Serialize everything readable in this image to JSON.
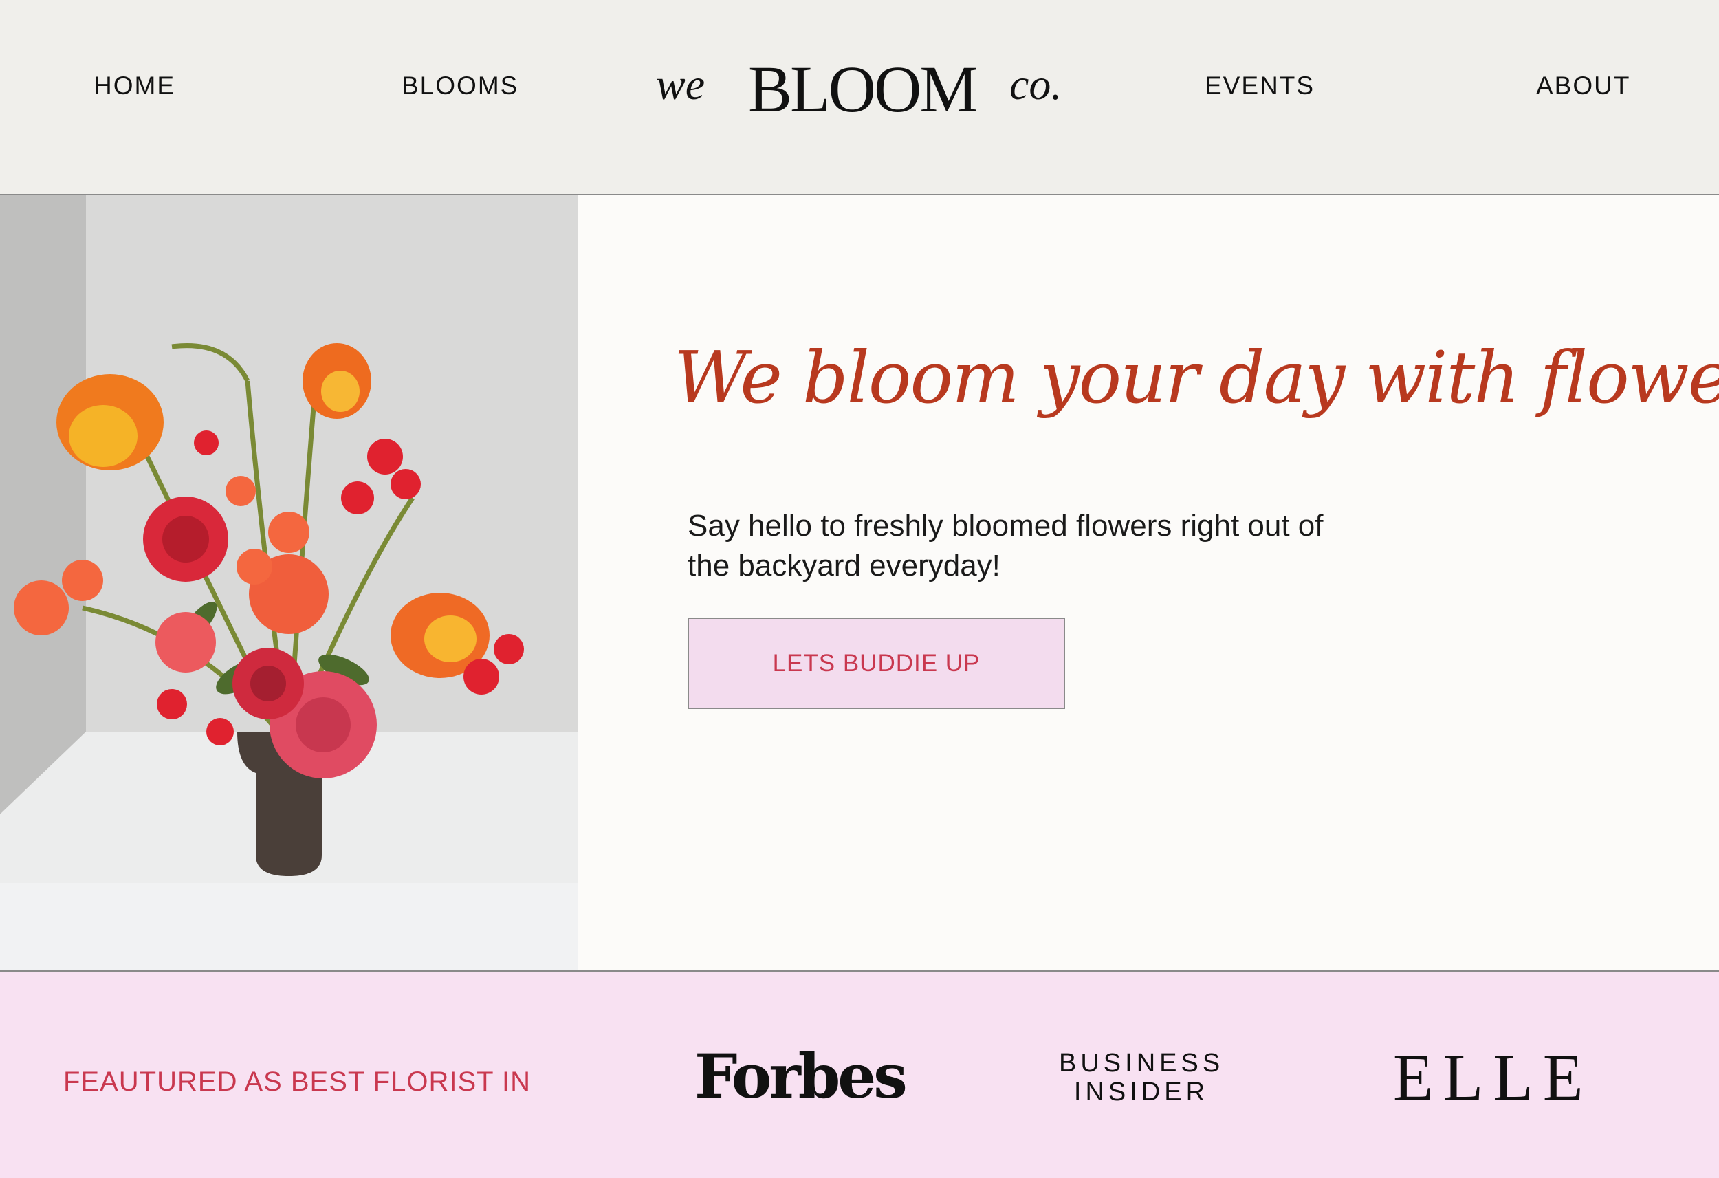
{
  "header": {
    "nav": {
      "home": "HOME",
      "blooms": "BLOOMS",
      "events": "EVENTS",
      "about": "ABOUT"
    },
    "logo": {
      "we": "we",
      "brand": "BLOOM",
      "co": "co."
    }
  },
  "hero": {
    "title": "We bloom your day with flowers",
    "subtitle": "Say hello to freshly bloomed flowers right out of the backyard everyday!",
    "cta_label": "LETS BUDDIE UP"
  },
  "featured": {
    "label": "FEAUTURED AS BEST FLORIST IN",
    "logos": {
      "forbes": "Forbes",
      "business_insider": "BUSINESS INSIDER",
      "elle": "ELLE"
    }
  },
  "colors": {
    "accent_red": "#b8391f",
    "cta_text": "#c9384f",
    "cta_bg": "#f3dcee",
    "featured_bg": "#f8e1f2",
    "header_bg": "#f0efeb"
  },
  "icons": {
    "hero_image": "flower-bouquet-photo"
  }
}
